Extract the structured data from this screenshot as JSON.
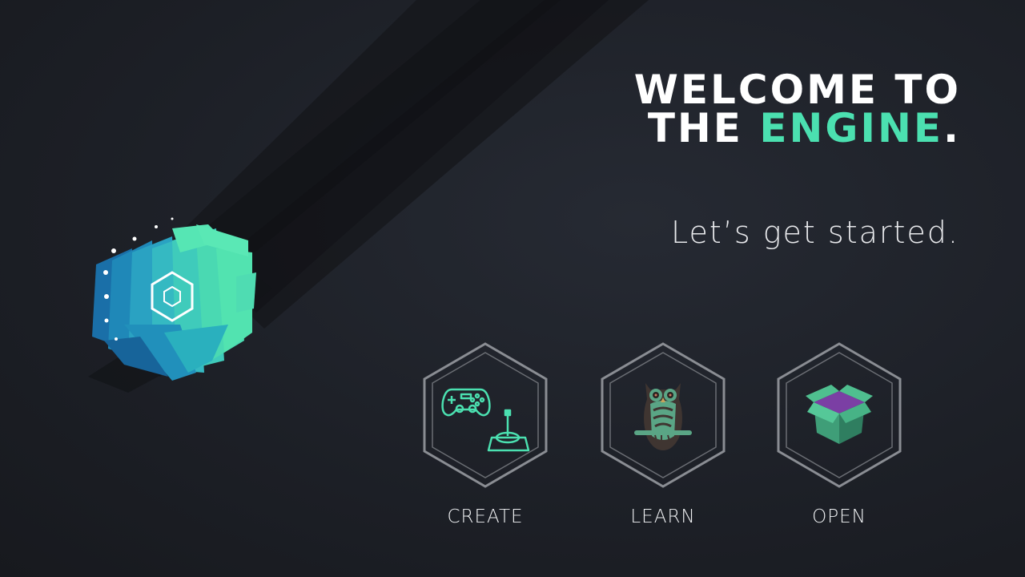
{
  "headline": {
    "line1": "WELCOME TO",
    "line2_prefix": "THE",
    "line2_accent": "ENGINE",
    "line2_suffix": "."
  },
  "subtitle": "Let’s get started.",
  "actions": [
    {
      "label": "CREATE",
      "icon": "gamepad-joystick-icon"
    },
    {
      "label": "LEARN",
      "icon": "owl-icon"
    },
    {
      "label": "OPEN",
      "icon": "box-icon"
    }
  ],
  "colors": {
    "accent": "#4be0b0",
    "background": "#1d2027",
    "hex_outline": "#8a8d93",
    "box_lid": "#7b3fa4"
  }
}
